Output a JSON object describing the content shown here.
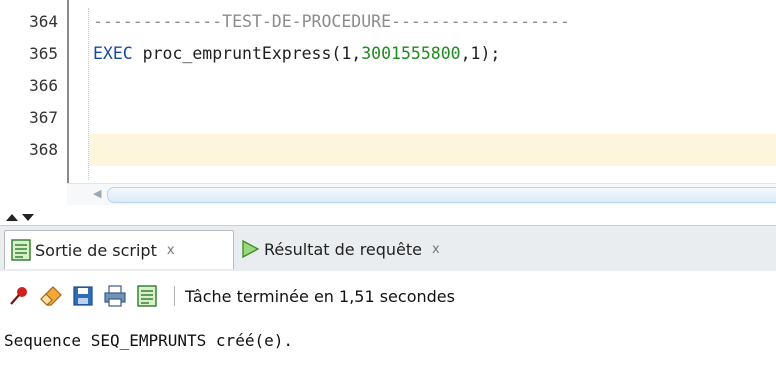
{
  "editor": {
    "lines": [
      {
        "number": "364",
        "tokens": [
          {
            "type": "comment",
            "text": "-------------TEST-DE-PROCEDURE------------------"
          }
        ]
      },
      {
        "number": "365",
        "tokens": [
          {
            "type": "keyword",
            "text": "EXEC"
          },
          {
            "type": "plain",
            "text": " proc_empruntExpress(1,"
          },
          {
            "type": "number",
            "text": "3001555800"
          },
          {
            "type": "plain",
            "text": ",1);"
          }
        ]
      },
      {
        "number": "366",
        "tokens": []
      },
      {
        "number": "367",
        "tokens": []
      },
      {
        "number": "368",
        "tokens": []
      }
    ],
    "current_line": "368"
  },
  "tabs": [
    {
      "label": "Sortie de script",
      "icon": "script-output-icon",
      "close": "x",
      "active": true
    },
    {
      "label": "Résultat de requête",
      "icon": "run-triangle-icon",
      "close": "x",
      "active": false
    }
  ],
  "toolbar": {
    "icons": [
      "pin-icon",
      "eraser-icon",
      "save-icon",
      "print-icon",
      "script-icon"
    ],
    "status": "Tâche terminée en 1,51 secondes"
  },
  "output": {
    "text": "Sequence SEQ_EMPRUNTS créé(e)."
  },
  "colors": {
    "keyword": "#1a4aa0",
    "number": "#1f8a1f",
    "comment": "#8c8c8c",
    "current_line_bg": "#fdf6dc"
  }
}
